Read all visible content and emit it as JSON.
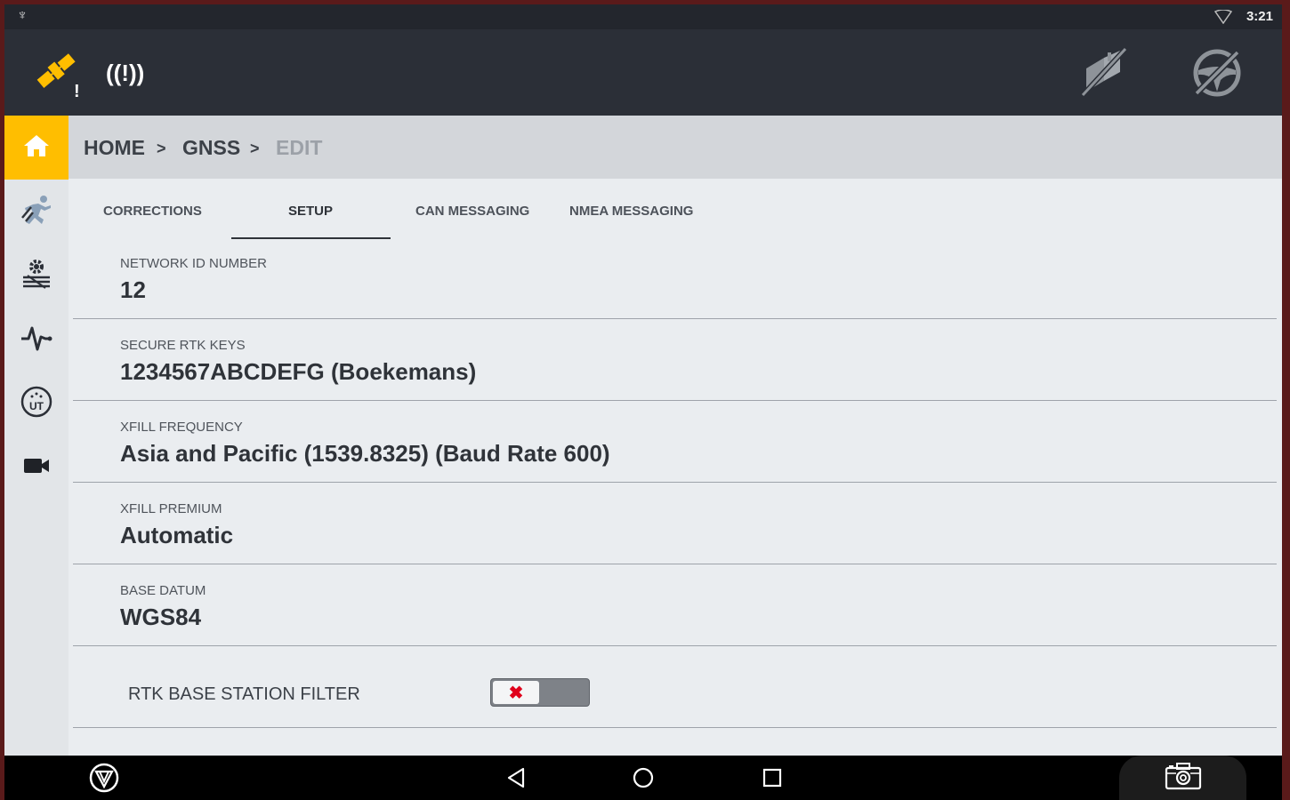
{
  "status_bar": {
    "time": "3:21",
    "icons": [
      "usb-icon",
      "wifi-icon"
    ]
  },
  "app_bar": {
    "icons": [
      "satellite-warning-icon",
      "signal-alert-icon",
      "no-coverage-icon",
      "steering-disabled-icon"
    ],
    "satellite_badge": "!",
    "signal_text": "((!))"
  },
  "sidebar": {
    "items": [
      {
        "icon": "home-icon"
      },
      {
        "icon": "guidance-runner-icon"
      },
      {
        "icon": "field-settings-icon"
      },
      {
        "icon": "diagnostics-pulse-icon"
      },
      {
        "icon": "ut-icon",
        "text": "UT"
      },
      {
        "icon": "camera-icon"
      }
    ],
    "accent": "#ffbe00"
  },
  "breadcrumb": {
    "items": [
      "HOME",
      "GNSS",
      "EDIT"
    ],
    "separator": ">"
  },
  "tabs": {
    "items": [
      "CORRECTIONS",
      "SETUP",
      "CAN MESSAGING",
      "NMEA MESSAGING"
    ],
    "active": "SETUP"
  },
  "fields": [
    {
      "label": "NETWORK ID NUMBER",
      "value": "12"
    },
    {
      "label": "SECURE RTK KEYS",
      "value": "1234567ABCDEFG (Boekemans)"
    },
    {
      "label": "XFILL FREQUENCY",
      "value": "Asia and Pacific (1539.8325) (Baud Rate 600)"
    },
    {
      "label": "XFILL PREMIUM",
      "value": "Automatic"
    },
    {
      "label": "BASE DATUM",
      "value": "WGS84"
    }
  ],
  "rtk_filter": {
    "label": "RTK BASE STATION FILTER",
    "enabled": false,
    "off_glyph": "✖",
    "off_color": "#e0001b"
  },
  "nav_bar": {
    "icons": [
      "trimble-icon",
      "back-icon",
      "home-circle-icon",
      "recents-icon",
      "screenshot-camera-icon"
    ]
  }
}
